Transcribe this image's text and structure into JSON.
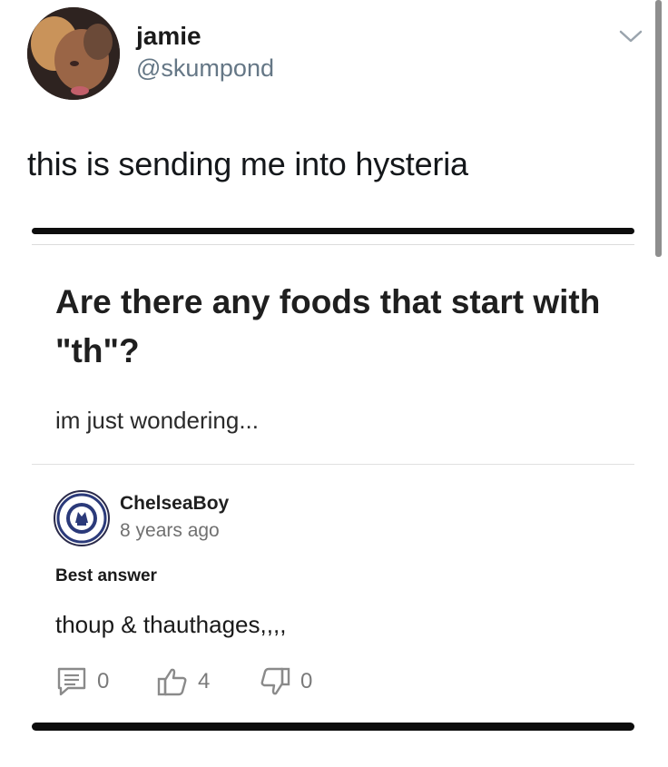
{
  "tweet": {
    "author": {
      "display_name": "jamie",
      "handle": "@skumpond",
      "avatar_icon": "user-photo-avatar"
    },
    "menu_icon": "chevron-down-icon",
    "text": "this is sending me into hysteria"
  },
  "embedded_post": {
    "question": "Are there any foods that start with \"th\"?",
    "details": "im just wondering...",
    "answer": {
      "author": "ChelseaBoy",
      "badge_icon": "chelsea-crest-icon",
      "time": "8 years ago",
      "label": "Best answer",
      "text": "thoup & thauthages,,,,",
      "actions": {
        "comments": {
          "icon": "comment-icon",
          "count": "0"
        },
        "likes": {
          "icon": "thumbs-up-icon",
          "count": "4"
        },
        "dislikes": {
          "icon": "thumbs-down-icon",
          "count": "0"
        }
      }
    }
  },
  "colors": {
    "text_primary": "#14171a",
    "text_secondary": "#657786",
    "divider": "#dcdcdc",
    "muted_count": "#7a7a7a"
  }
}
